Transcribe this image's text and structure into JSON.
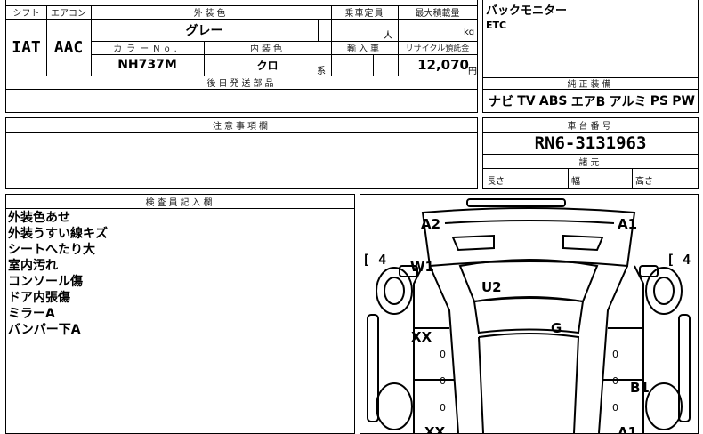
{
  "spec": {
    "shift_label": "シフト",
    "aircon_label": "エアコン",
    "exterior_color_label": "外装色",
    "capacity_label": "乗車定員",
    "max_load_label": "最大積載量",
    "shift_value": "IAT",
    "aircon_value": "AAC",
    "exterior_color_value": "グレー",
    "capacity_unit": "人",
    "load_unit": "kg",
    "color_no_label": "カラーNo.",
    "interior_color_label": "内装色",
    "import_label": "輸入車",
    "recycle_label": "リサイクル預託金",
    "color_no_value": "NH737M",
    "interior_color_value": "クロ",
    "interior_suffix": "系",
    "recycle_value": "12,070",
    "recycle_unit": "円",
    "later_parts_label": "後日発送部品"
  },
  "equipment": {
    "lines": [
      "バックモニター",
      "ETC"
    ],
    "genuine_label": "純正装備",
    "items": [
      "ナビ",
      "TV",
      "ABS",
      "エアB",
      "アルミ",
      "PS",
      "PW"
    ]
  },
  "caution": {
    "label": "注意事項欄"
  },
  "chassis": {
    "label": "車台番号",
    "number": "RN6-3131963",
    "dimensions_label": "諸元",
    "length_label": "長さ",
    "width_label": "幅",
    "height_label": "高さ"
  },
  "inspector": {
    "label": "検査員記入欄",
    "notes": [
      "外装色あせ",
      "外装うすい線キズ",
      "シートへたり大",
      "室内汚れ",
      "コンソール傷",
      "ドア内張傷",
      "ミラーA",
      "バンパー下A"
    ]
  },
  "diagram": {
    "marks": {
      "a2_front_left": "A2",
      "a1_front_right": "A1",
      "w1": "W1",
      "u2": "U2",
      "g": "G",
      "xx_left": "XX",
      "b1": "B1",
      "xx_bottom": "XX",
      "a1_bottom": "A1"
    },
    "tire_left": "4",
    "tire_right": "4",
    "zero_marks": [
      "0",
      "0",
      "0",
      "0",
      "0",
      "0"
    ]
  }
}
